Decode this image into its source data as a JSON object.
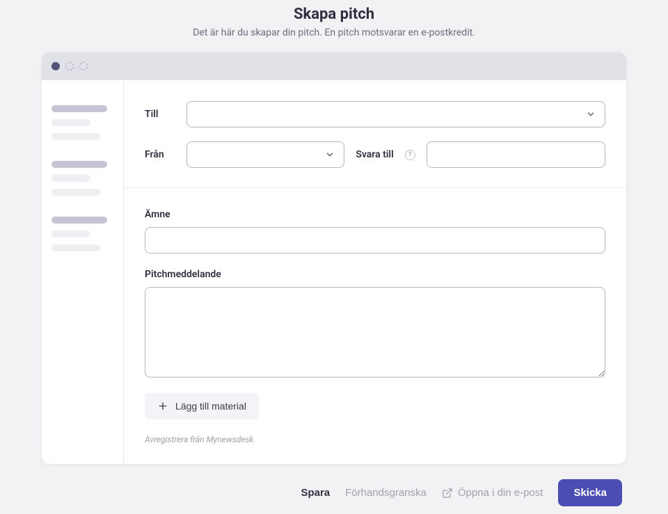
{
  "header": {
    "title": "Skapa pitch",
    "subtitle": "Det är här du skapar din pitch. En pitch motsvarar en e-postkredit."
  },
  "form": {
    "to_label": "Till",
    "from_label": "Från",
    "reply_to_label": "Svara till",
    "subject_label": "Ämne",
    "message_label": "Pitchmeddelande",
    "add_material_label": "Lägg till material",
    "unsubscribe_text": "Avregistrera från Mynewsdesk",
    "to_value": "",
    "from_value": "",
    "reply_to_value": "",
    "subject_value": "",
    "message_value": ""
  },
  "footer": {
    "save_label": "Spara",
    "preview_label": "Förhandsgranska",
    "open_email_label": "Öppna i din e-post",
    "send_label": "Skicka"
  }
}
